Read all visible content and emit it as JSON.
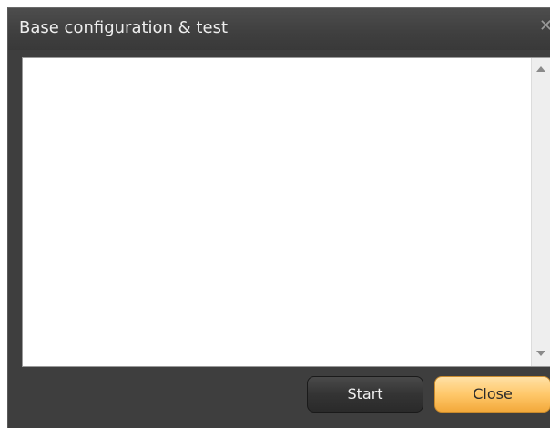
{
  "window": {
    "title": "Base configuration & test",
    "close_glyph": "✕",
    "close_icon": "close-icon"
  },
  "log": {
    "content": "",
    "scrollbar": {
      "up_icon": "scroll-up-arrow-icon",
      "down_icon": "scroll-down-arrow-icon"
    }
  },
  "buttons": {
    "start_label": "Start",
    "close_label": "Close"
  },
  "colors": {
    "window_bg": "#3e3e3e",
    "title_text": "#eeeeee",
    "start_button": "#343434",
    "close_button_accent": "#ffc86a"
  }
}
